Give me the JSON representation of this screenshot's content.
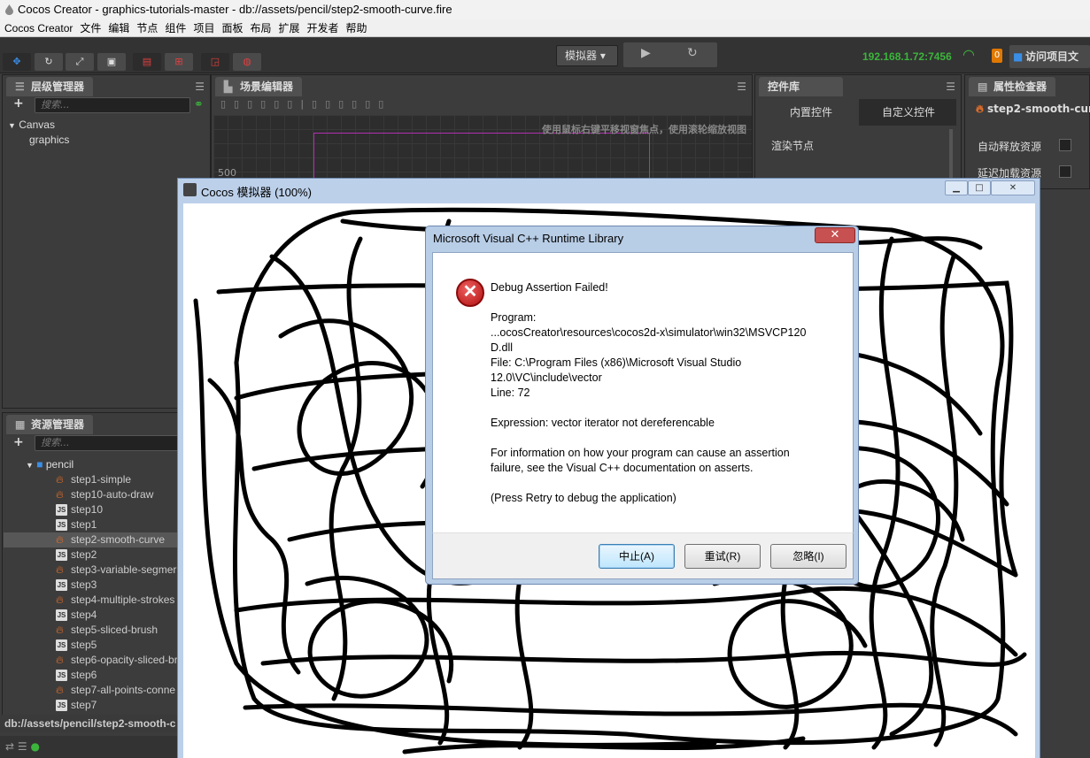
{
  "window": {
    "title": "Cocos Creator - graphics-tutorials-master - db://assets/pencil/step2-smooth-curve.fire"
  },
  "menu": [
    "Cocos Creator",
    "文件",
    "编辑",
    "节点",
    "组件",
    "项目",
    "面板",
    "布局",
    "扩展",
    "开发者",
    "帮助"
  ],
  "toolbar": {
    "simulator_label": "模拟器",
    "ip": "192.168.1.72:7456",
    "badge_count": "0",
    "visit_label": "访问项目文"
  },
  "hierarchy": {
    "tab": "层级管理器",
    "search_placeholder": "搜索...",
    "nodes": [
      "Canvas",
      "graphics"
    ]
  },
  "scene": {
    "tab": "场景编辑器",
    "hint": "使用鼠标右键平移视窗焦点，使用滚轮缩放视图",
    "axis_label": "500"
  },
  "library": {
    "tab": "控件库",
    "builtin_tab": "内置控件",
    "custom_tab": "自定义控件",
    "section": "渲染节点"
  },
  "inspector": {
    "tab": "属性检查器",
    "node_name": "step2-smooth-curv",
    "auto_release": "自动释放资源",
    "lazy_load": "延迟加载资源"
  },
  "assets": {
    "tab": "资源管理器",
    "search_placeholder": "搜索...",
    "folder": "pencil",
    "items": [
      {
        "name": "step1-simple",
        "type": "fire"
      },
      {
        "name": "step10-auto-draw",
        "type": "fire"
      },
      {
        "name": "step10",
        "type": "js"
      },
      {
        "name": "step1",
        "type": "js"
      },
      {
        "name": "step2-smooth-curve",
        "type": "fire",
        "selected": true
      },
      {
        "name": "step2",
        "type": "js"
      },
      {
        "name": "step3-variable-segmer",
        "type": "fire"
      },
      {
        "name": "step3",
        "type": "js"
      },
      {
        "name": "step4-multiple-strokes",
        "type": "fire"
      },
      {
        "name": "step4",
        "type": "js"
      },
      {
        "name": "step5-sliced-brush",
        "type": "fire"
      },
      {
        "name": "step5",
        "type": "js"
      },
      {
        "name": "step6-opacity-sliced-br",
        "type": "fire"
      },
      {
        "name": "step6",
        "type": "js"
      },
      {
        "name": "step7-all-points-conne",
        "type": "fire"
      },
      {
        "name": "step7",
        "type": "js"
      }
    ],
    "status_path": "db://assets/pencil/step2-smooth-c"
  },
  "simulator": {
    "title": "Cocos 模拟器 (100%)"
  },
  "dialog": {
    "title": "Microsoft Visual C++ Runtime Library",
    "heading": "Debug Assertion Failed!",
    "lines": [
      "Program:",
      "...ocosCreator\\resources\\cocos2d-x\\simulator\\win32\\MSVCP120",
      "D.dll",
      "File: C:\\Program Files (x86)\\Microsoft Visual Studio",
      "12.0\\VC\\include\\vector",
      "Line: 72",
      "",
      "Expression: vector iterator not dereferencable",
      "",
      "For information on how your program can cause an assertion",
      "failure, see the Visual C++ documentation on asserts.",
      "",
      "(Press Retry to debug the application)"
    ],
    "buttons": {
      "abort": "中止(A)",
      "retry": "重试(R)",
      "ignore": "忽略(I)"
    }
  },
  "colors": {
    "accent_green": "#3cb43c",
    "fire_orange": "#e8702a",
    "badge_orange": "#e07800",
    "panel_bg": "#3c3c3c"
  }
}
